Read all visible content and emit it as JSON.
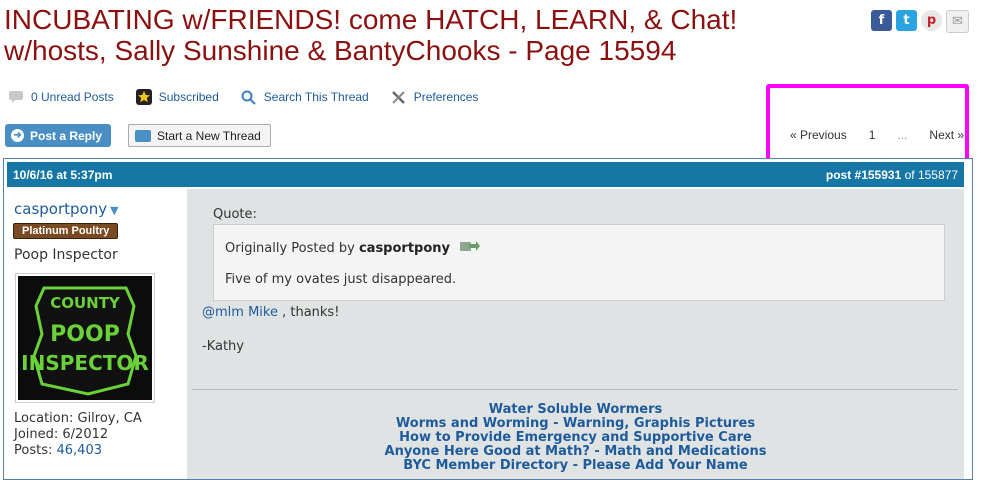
{
  "thread": {
    "title": "INCUBATING w/FRIENDS! come HATCH, LEARN, & Chat! w/hosts, Sally Sunshine & BantyChooks - Page 15594"
  },
  "share": {
    "facebook": "f",
    "twitter": "t",
    "pinterest": "p",
    "email": "✉"
  },
  "toolbar": {
    "unread": "0 Unread Posts",
    "subscribed": "Subscribed",
    "search": "Search This Thread",
    "preferences": "Preferences"
  },
  "actions": {
    "post_reply": "Post a Reply",
    "new_thread": "Start a New Thread"
  },
  "pager": {
    "previous": "« Previous",
    "page1": "1",
    "dots": "...",
    "next": "Next »"
  },
  "post": {
    "date": "10/6/16 at 5:37pm",
    "number": "post #155931",
    "of": "of 155877",
    "user": {
      "name": "casportpony",
      "badge": "Platinum Poultry",
      "title": "Poop Inspector",
      "avatar_lines": [
        "COUNTY",
        "POOP",
        "INSPECTOR"
      ],
      "location": "Location: Gilroy, CA",
      "joined": "Joined: 6/2012",
      "posts_label": "Posts: ",
      "posts": "46,403"
    },
    "quote_label": "Quote:",
    "quote_by_prefix": "Originally Posted by ",
    "quote_by": "casportpony",
    "quote_text": "Five of my ovates just disappeared.",
    "mention": "@mlm Mike",
    "reply_rest": " , thanks!",
    "signoff": "-Kathy",
    "signature": [
      "Water Soluble Wormers",
      "Worms and Worming - Warning, Graphis Pictures",
      "How to Provide Emergency and Supportive Care",
      "Anyone Here Good at Math? - Math and Medications",
      "BYC Member Directory - Please Add Your Name"
    ]
  },
  "colors": {
    "title": "#8b1111",
    "header_bar": "#1677a7",
    "highlight": "#ff00ff",
    "link": "#1f5b9a"
  }
}
